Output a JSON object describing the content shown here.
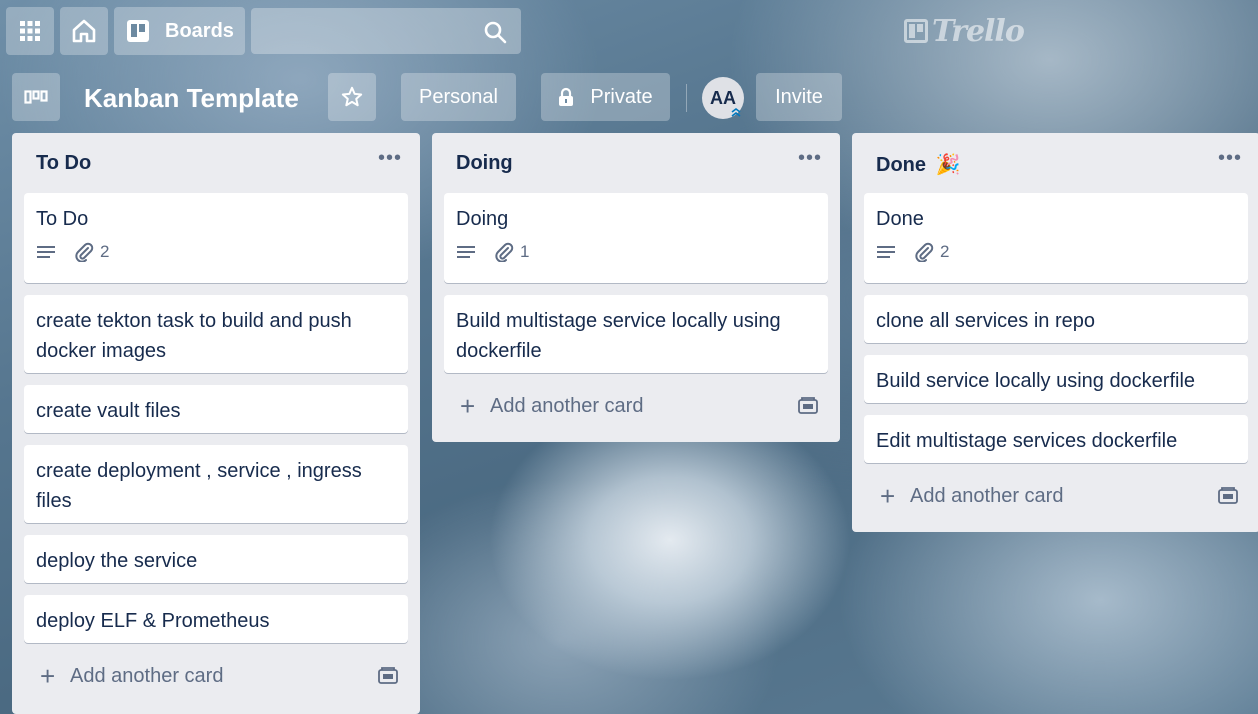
{
  "header": {
    "boards_label": "Boards",
    "search_placeholder": "",
    "logo_text": "Trello"
  },
  "board": {
    "title": "Kanban Template",
    "visibility_team": "Personal",
    "visibility_privacy": "Private",
    "member_initials": "AA",
    "invite_label": "Invite"
  },
  "lists": [
    {
      "title": "To Do",
      "emoji": "",
      "cards": [
        {
          "text": "To Do",
          "has_description": true,
          "attachments": "2"
        },
        {
          "text": "create tekton task to build and push docker images"
        },
        {
          "text": "create vault files"
        },
        {
          "text": "create deployment , service , ingress files"
        },
        {
          "text": "deploy the service"
        },
        {
          "text": "deploy ELF & Prometheus"
        }
      ],
      "add_label": "Add another card"
    },
    {
      "title": "Doing",
      "emoji": "",
      "cards": [
        {
          "text": "Doing",
          "has_description": true,
          "attachments": "1"
        },
        {
          "text": "Build multistage service locally using dockerfile"
        }
      ],
      "add_label": "Add another card"
    },
    {
      "title": "Done",
      "emoji": "🎉",
      "cards": [
        {
          "text": "Done",
          "has_description": true,
          "attachments": "2"
        },
        {
          "text": "clone all services in repo"
        },
        {
          "text": "Build service locally using dockerfile"
        },
        {
          "text": "Edit multistage services dockerfile"
        }
      ],
      "add_label": "Add another card"
    }
  ],
  "icons": {
    "apps": "grid-icon",
    "home": "home-icon",
    "boards": "board-icon",
    "search": "search-icon",
    "board_menu": "board-switch-icon",
    "star": "star-icon",
    "lock": "lock-icon",
    "description": "description-icon",
    "attachment": "paperclip-icon",
    "template": "card-template-icon"
  }
}
